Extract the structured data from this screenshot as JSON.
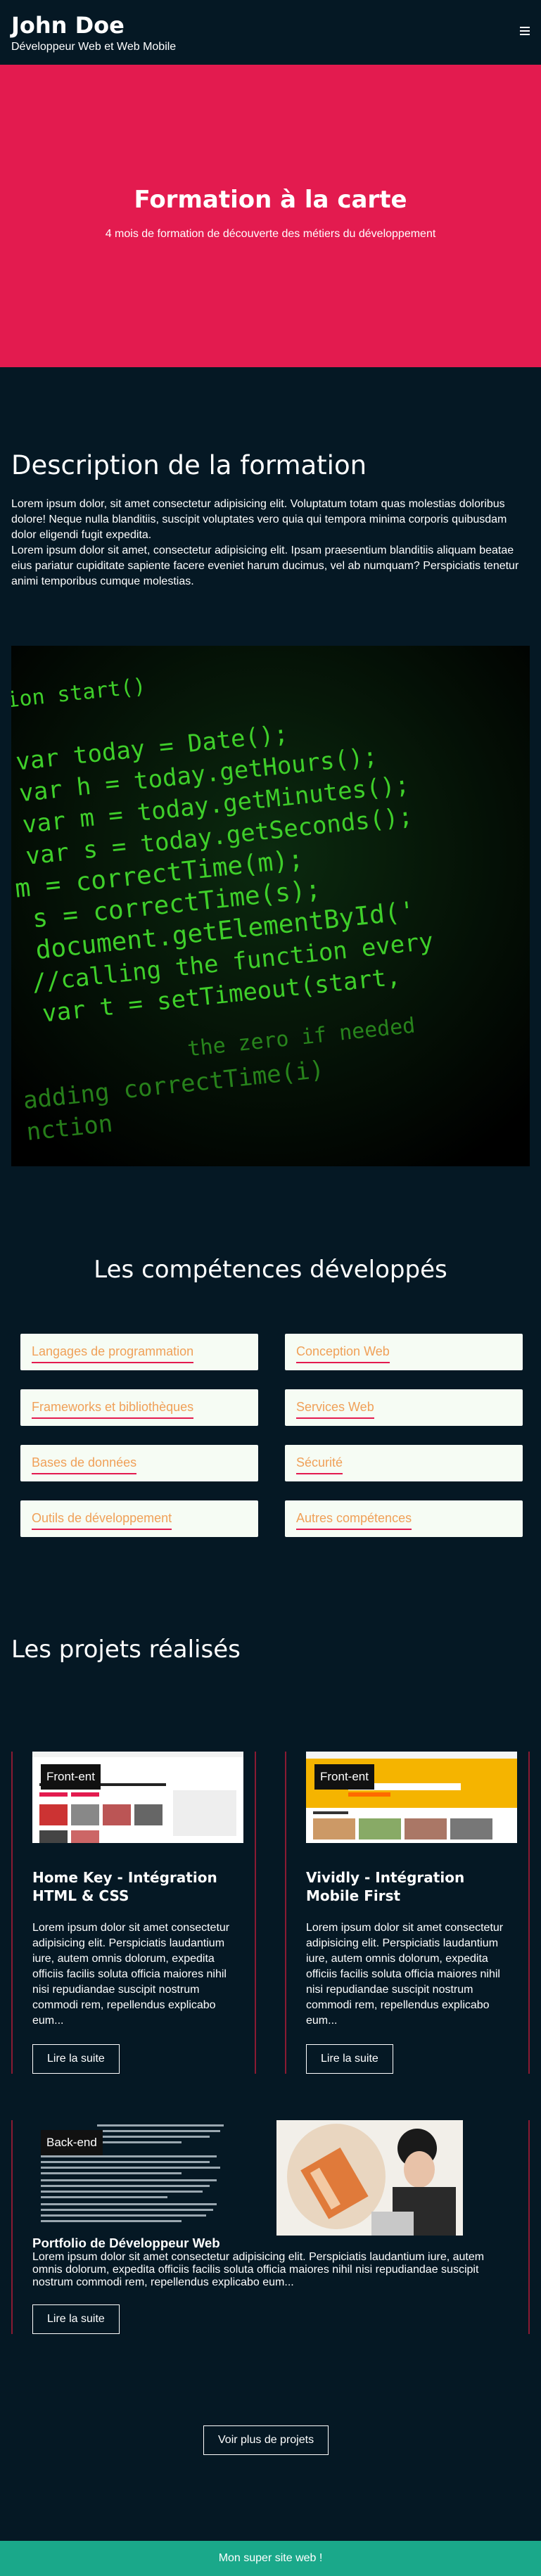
{
  "header": {
    "name": "John Doe",
    "subtitle": "Développeur Web et Web Mobile"
  },
  "hero": {
    "title": "Formation à la carte",
    "subtitle": "4 mois de formation de découverte des métiers du développement"
  },
  "description": {
    "title": "Description de la formation",
    "text": "Lorem ipsum dolor, sit amet consectetur adipisicing elit. Voluptatum totam quas molestias doloribus dolore! Neque nulla blanditiis, suscipit voluptates vero quia qui tempora minima corporis quibusdam dolor eligendi fugit expedita.\nLorem ipsum dolor sit amet, consectetur adipisicing elit. Ipsam praesentium blanditiis aliquam beatae eius pariatur cupiditate sapiente facere eveniet harum ducimus, vel ab numquam? Perspiciatis tenetur animi temporibus cumque molestias."
  },
  "code_image": {
    "lines": [
      "ction start()",
      "var today = Date();",
      "var h = today.getHours();",
      "var m = today.getMinutes();",
      "var s = today.getSeconds();",
      "m = correctTime(m);",
      "s = correctTime(s);",
      "document.getElementById('",
      "//calling the function every",
      "var t = setTimeout(start,",
      "the zero if needed",
      "adding correctTime(i)",
      "nction"
    ]
  },
  "skills": {
    "title": "Les compétences développés",
    "items": [
      "Langages de programmation",
      "Conception Web",
      "Frameworks et bibliothèques",
      "Services Web",
      "Bases de données",
      "Sécurité",
      "Outils de développement",
      "Autres compétences"
    ]
  },
  "projects": {
    "title": "Les projets réalisés",
    "items": [
      {
        "badge": "Front-ent",
        "title": "Home Key - Intégration HTML & CSS",
        "text": "Lorem ipsum dolor sit amet consectetur adipisicing elit. Perspiciatis laudantium iure, autem omnis dolorum, expedita officiis facilis soluta officia maiores nihil nisi repudiandae suscipit nostrum commodi rem, repellendus explicabo eum...",
        "button": "Lire la suite"
      },
      {
        "badge": "Front-ent",
        "title": "Vividly - Intégration Mobile First",
        "text": "Lorem ipsum dolor sit amet consectetur adipisicing elit. Perspiciatis laudantium iure, autem omnis dolorum, expedita officiis facilis soluta officia maiores nihil nisi repudiandae suscipit nostrum commodi rem, repellendus explicabo eum...",
        "button": "Lire la suite"
      },
      {
        "badge": "Back-end",
        "title": "Portfolio de Développeur Web",
        "text": "Lorem ipsum dolor sit amet consectetur adipisicing elit. Perspiciatis laudantium iure, autem omnis dolorum, expedita officiis facilis soluta officia maiores nihil nisi repudiandae suscipit nostrum commodi rem, repellendus explicabo eum...",
        "button": "Lire la suite"
      }
    ],
    "more_button": "Voir plus de projets"
  },
  "footer": {
    "text": "Mon super site web !"
  }
}
